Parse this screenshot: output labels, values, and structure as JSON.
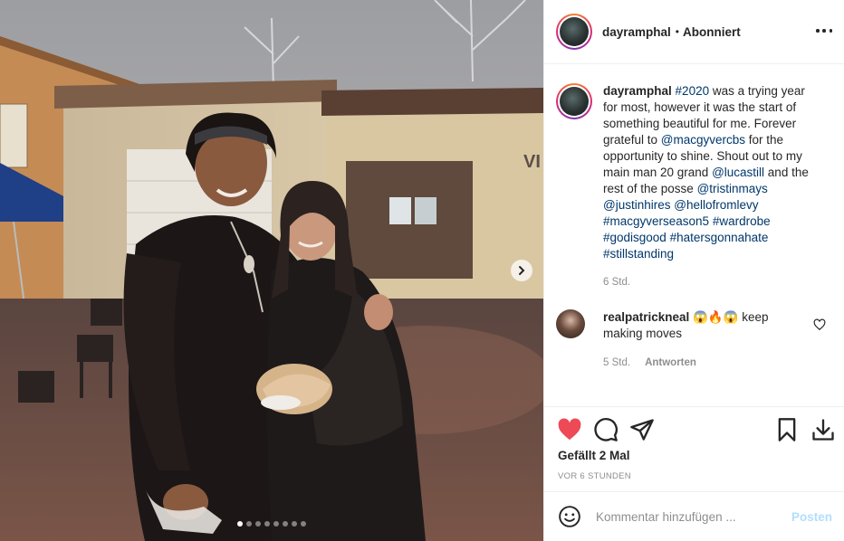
{
  "post": {
    "photo_alt": "",
    "current_slide": 1,
    "slide_count": 8
  },
  "header": {
    "username": "dayramphal",
    "separator": "•",
    "follow_state": "Abonniert"
  },
  "caption": {
    "username": "dayramphal",
    "segments": [
      {
        "t": "#2020",
        "tag": true
      },
      {
        "t": " was a trying year for most, however it was the start of something beautiful for me. Forever grateful to ",
        "tag": false
      },
      {
        "t": "@macgyvercbs",
        "tag": true
      },
      {
        "t": " for the opportunity to shine. Shout out to my main man 20 grand ",
        "tag": false
      },
      {
        "t": "@lucastill",
        "tag": true
      },
      {
        "t": " and the rest of the posse ",
        "tag": false
      },
      {
        "t": "@tristinmays",
        "tag": true
      },
      {
        "t": " ",
        "tag": false
      },
      {
        "t": "@justinhires",
        "tag": true
      },
      {
        "t": " ",
        "tag": false
      },
      {
        "t": "@hellofromlevy",
        "tag": true
      },
      {
        "t": " ",
        "tag": false
      },
      {
        "t": "#macgyverseason5",
        "tag": true
      },
      {
        "t": " ",
        "tag": false
      },
      {
        "t": "#wardrobe",
        "tag": true
      },
      {
        "t": " ",
        "tag": false
      },
      {
        "t": "#godisgood",
        "tag": true
      },
      {
        "t": " ",
        "tag": false
      },
      {
        "t": "#hatersgonnahate",
        "tag": true
      },
      {
        "t": " ",
        "tag": false
      },
      {
        "t": "#stillstanding",
        "tag": true
      }
    ],
    "time": "6 Std."
  },
  "comments": [
    {
      "username": "realpatrickneal",
      "text": "😱🔥😱 keep making moves",
      "time": "5 Std.",
      "reply_label": "Antworten"
    }
  ],
  "actions": {
    "liked": true
  },
  "likes_text": "Gefällt 2 Mal",
  "posted_text": "VOR 6 STUNDEN",
  "composer": {
    "placeholder": "Kommentar hinzufügen ...",
    "post_label": "Posten"
  },
  "colors": {
    "like_red": "#ed4956",
    "link_blue": "#00376b",
    "post_disabled": "#b2dffc",
    "muted": "#8e8e8e"
  }
}
